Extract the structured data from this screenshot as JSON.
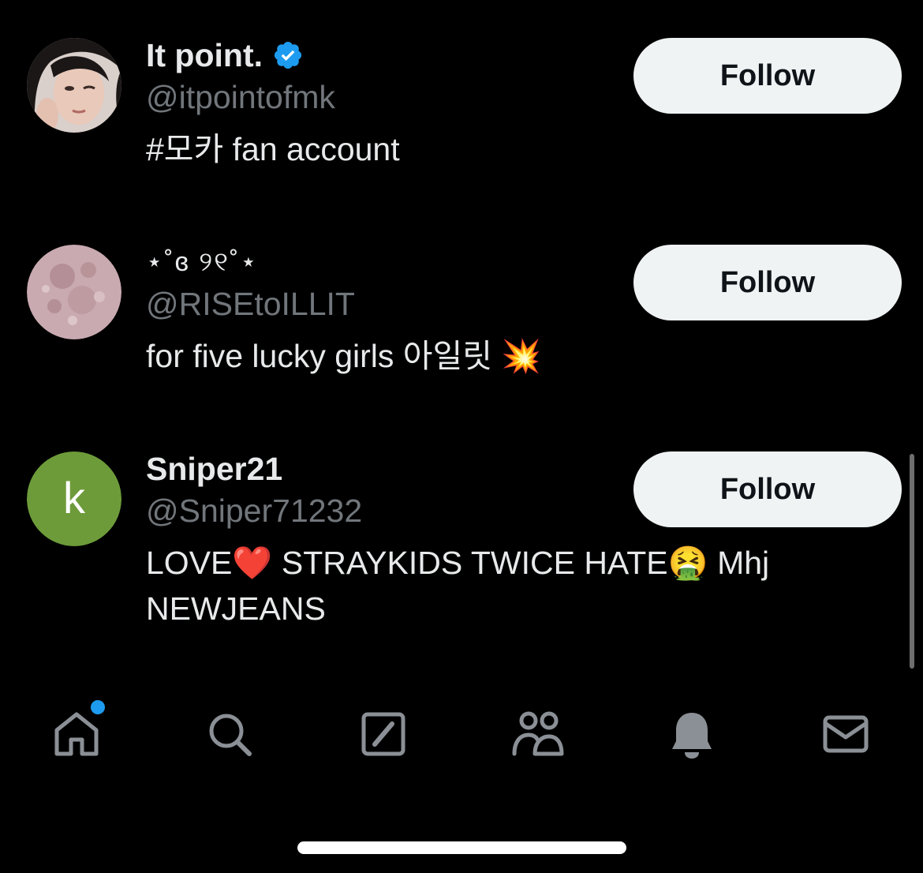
{
  "users": [
    {
      "display_name": "It point.",
      "verified": true,
      "handle": "@itpointofmk",
      "bio": "#모카 fan account",
      "follow_label": "Follow"
    },
    {
      "display_name": "⋆˚ɞ ୨୧˚⋆",
      "verified": false,
      "handle": "@RISEtoILLIT",
      "bio": "for five lucky girls 아일릿 💥",
      "follow_label": "Follow"
    },
    {
      "display_name": "Sniper21",
      "verified": false,
      "handle": "@Sniper71232",
      "avatar_letter": "k",
      "bio_parts": [
        "LOVE",
        "❤️",
        " STRAYKIDS TWICE HATE",
        "🤮",
        " Mhj NEWJEANS"
      ],
      "follow_label": "Follow"
    }
  ],
  "icons": {
    "verified": "verified-badge-icon",
    "home": "home-icon",
    "search": "search-icon",
    "grok": "grok-icon",
    "communities": "communities-icon",
    "notifications": "bell-icon",
    "messages": "mail-icon"
  },
  "colors": {
    "background": "#000000",
    "primary_text": "#e7e9ea",
    "secondary_text": "#71767b",
    "follow_button_bg": "#eff3f4",
    "verified_blue": "#1d9bf0",
    "tab_icon": "#8b9096"
  },
  "tabbar": {
    "active": "home",
    "home_has_notification_dot": true
  }
}
